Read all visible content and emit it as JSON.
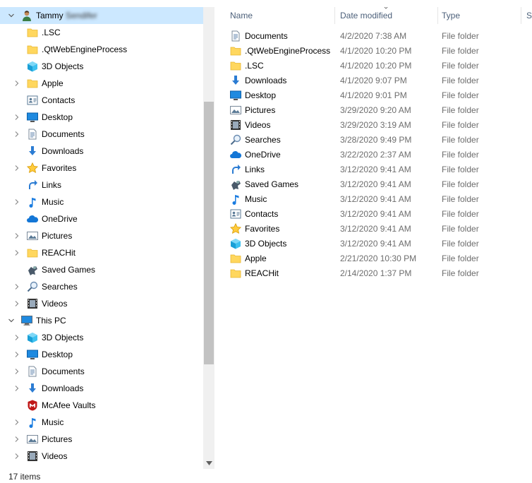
{
  "nav": {
    "items": [
      {
        "label": "Tammy Sendifer",
        "icon": "user-icon",
        "chevron": "down",
        "indent": 0,
        "selected": true,
        "blurred": true
      },
      {
        "label": ".LSC",
        "icon": "folder-icon",
        "chevron": "none",
        "indent": 1
      },
      {
        "label": ".QtWebEngineProcess",
        "icon": "folder-icon",
        "chevron": "none",
        "indent": 1
      },
      {
        "label": "3D Objects",
        "icon": "3d-objects-icon",
        "chevron": "none",
        "indent": 1
      },
      {
        "label": "Apple",
        "icon": "folder-icon",
        "chevron": "right",
        "indent": 1
      },
      {
        "label": "Contacts",
        "icon": "contacts-icon",
        "chevron": "none",
        "indent": 1
      },
      {
        "label": "Desktop",
        "icon": "desktop-icon",
        "chevron": "right",
        "indent": 1
      },
      {
        "label": "Documents",
        "icon": "documents-icon",
        "chevron": "right",
        "indent": 1
      },
      {
        "label": "Downloads",
        "icon": "downloads-icon",
        "chevron": "none",
        "indent": 1
      },
      {
        "label": "Favorites",
        "icon": "favorites-icon",
        "chevron": "right",
        "indent": 1
      },
      {
        "label": "Links",
        "icon": "links-icon",
        "chevron": "none",
        "indent": 1
      },
      {
        "label": "Music",
        "icon": "music-icon",
        "chevron": "right",
        "indent": 1
      },
      {
        "label": "OneDrive",
        "icon": "onedrive-icon",
        "chevron": "none",
        "indent": 1
      },
      {
        "label": "Pictures",
        "icon": "pictures-icon",
        "chevron": "right",
        "indent": 1
      },
      {
        "label": "REACHit",
        "icon": "folder-icon",
        "chevron": "right",
        "indent": 1
      },
      {
        "label": "Saved Games",
        "icon": "saved-games-icon",
        "chevron": "none",
        "indent": 1
      },
      {
        "label": "Searches",
        "icon": "searches-icon",
        "chevron": "right",
        "indent": 1
      },
      {
        "label": "Videos",
        "icon": "videos-icon",
        "chevron": "right",
        "indent": 1
      },
      {
        "label": "This PC",
        "icon": "this-pc-icon",
        "chevron": "down",
        "indent": 0
      },
      {
        "label": "3D Objects",
        "icon": "3d-objects-icon",
        "chevron": "right",
        "indent": 1
      },
      {
        "label": "Desktop",
        "icon": "desktop-icon",
        "chevron": "right",
        "indent": 1
      },
      {
        "label": "Documents",
        "icon": "documents-icon",
        "chevron": "right",
        "indent": 1
      },
      {
        "label": "Downloads",
        "icon": "downloads-icon",
        "chevron": "right",
        "indent": 1
      },
      {
        "label": "McAfee Vaults",
        "icon": "mcafee-icon",
        "chevron": "none",
        "indent": 1
      },
      {
        "label": "Music",
        "icon": "music-icon",
        "chevron": "right",
        "indent": 1
      },
      {
        "label": "Pictures",
        "icon": "pictures-icon",
        "chevron": "right",
        "indent": 1
      },
      {
        "label": "Videos",
        "icon": "videos-icon",
        "chevron": "right",
        "indent": 1
      }
    ]
  },
  "list": {
    "columns": {
      "name": "Name",
      "date": "Date modified",
      "type": "Type",
      "size": "Si"
    },
    "rows": [
      {
        "name": "Documents",
        "date": "4/2/2020 7:38 AM",
        "type": "File folder",
        "icon": "documents-icon"
      },
      {
        "name": ".QtWebEngineProcess",
        "date": "4/1/2020 10:20 PM",
        "type": "File folder",
        "icon": "folder-icon"
      },
      {
        "name": ".LSC",
        "date": "4/1/2020 10:20 PM",
        "type": "File folder",
        "icon": "folder-icon"
      },
      {
        "name": "Downloads",
        "date": "4/1/2020 9:07 PM",
        "type": "File folder",
        "icon": "downloads-icon"
      },
      {
        "name": "Desktop",
        "date": "4/1/2020 9:01 PM",
        "type": "File folder",
        "icon": "desktop-icon"
      },
      {
        "name": "Pictures",
        "date": "3/29/2020 9:20 AM",
        "type": "File folder",
        "icon": "pictures-icon"
      },
      {
        "name": "Videos",
        "date": "3/29/2020 3:19 AM",
        "type": "File folder",
        "icon": "videos-icon"
      },
      {
        "name": "Searches",
        "date": "3/28/2020 9:49 PM",
        "type": "File folder",
        "icon": "searches-icon"
      },
      {
        "name": "OneDrive",
        "date": "3/22/2020 2:37 AM",
        "type": "File folder",
        "icon": "onedrive-icon"
      },
      {
        "name": "Links",
        "date": "3/12/2020 9:41 AM",
        "type": "File folder",
        "icon": "links-icon"
      },
      {
        "name": "Saved Games",
        "date": "3/12/2020 9:41 AM",
        "type": "File folder",
        "icon": "saved-games-icon"
      },
      {
        "name": "Music",
        "date": "3/12/2020 9:41 AM",
        "type": "File folder",
        "icon": "music-icon"
      },
      {
        "name": "Contacts",
        "date": "3/12/2020 9:41 AM",
        "type": "File folder",
        "icon": "contacts-icon"
      },
      {
        "name": "Favorites",
        "date": "3/12/2020 9:41 AM",
        "type": "File folder",
        "icon": "favorites-icon"
      },
      {
        "name": "3D Objects",
        "date": "3/12/2020 9:41 AM",
        "type": "File folder",
        "icon": "3d-objects-icon"
      },
      {
        "name": "Apple",
        "date": "2/21/2020 10:30 PM",
        "type": "File folder",
        "icon": "folder-icon"
      },
      {
        "name": "REACHit",
        "date": "2/14/2020 1:37 PM",
        "type": "File folder",
        "icon": "folder-icon"
      }
    ]
  },
  "status": {
    "item_count": "17 items"
  },
  "colors": {
    "selection": "#cce8ff",
    "header_text": "#4c607a",
    "secondary_text": "#6d6d6d",
    "folder": "#ffd75e"
  }
}
